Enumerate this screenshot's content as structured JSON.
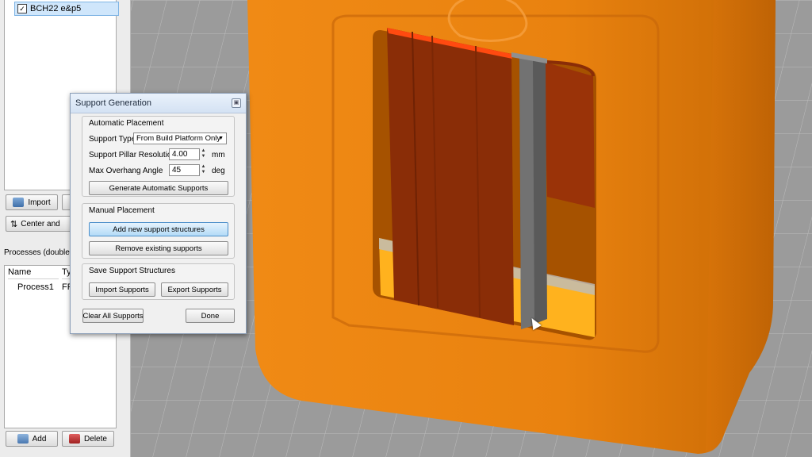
{
  "model_list": {
    "item_label": "BCH22 e&p5",
    "checked": true
  },
  "left_buttons": {
    "import_label": "Import",
    "center_label": "Center and",
    "add_label": "Add",
    "delete_label": "Delete"
  },
  "processes": {
    "label": "Processes (double-cli",
    "columns": [
      "Name",
      "Ty"
    ],
    "rows": [
      [
        "Process1",
        "FF"
      ]
    ]
  },
  "dialog": {
    "title": "Support Generation",
    "automatic": {
      "group_label": "Automatic Placement",
      "support_type_label": "Support Type",
      "support_type_value": "From Build Platform Only",
      "resolution_label": "Support Pillar Resolution",
      "resolution_value": "4.00",
      "resolution_unit": "mm",
      "overhang_label": "Max Overhang Angle",
      "overhang_value": "45",
      "overhang_unit": "deg",
      "generate_button": "Generate Automatic Supports"
    },
    "manual": {
      "group_label": "Manual Placement",
      "add_button": "Add new support structures",
      "remove_button": "Remove existing supports"
    },
    "save": {
      "group_label": "Save Support Structures",
      "import_button": "Import Supports",
      "export_button": "Export Supports"
    },
    "clear_button": "Clear All Supports",
    "done_button": "Done"
  },
  "colors": {
    "model_orange": "#e9820f",
    "support_red": "#8a2d07",
    "pillar_gray": "#5a5a5a",
    "grid_background": "#9a9a9a",
    "highlight_blue": "#b3dbf7"
  }
}
